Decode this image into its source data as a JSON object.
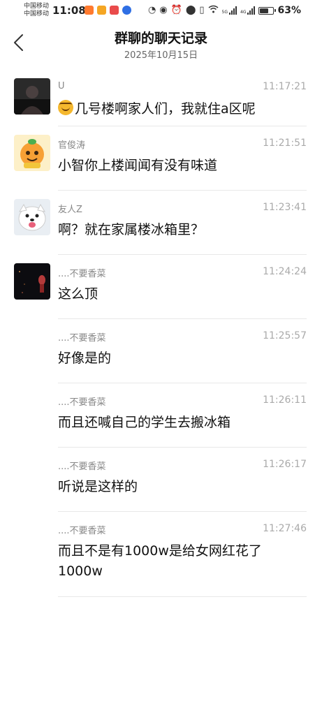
{
  "status_bar": {
    "carrier_1": "中国移动",
    "carrier_2": "中国移动",
    "time": "11:08",
    "battery_percent": "63%",
    "battery_level": 0.63,
    "app_icon_colors": [
      "#ff7a2f",
      "#f5a623",
      "#e94b4b",
      "#2f6fe4"
    ],
    "icons": [
      "speed-icon",
      "eye-icon",
      "alarm-icon",
      "location-icon",
      "vibrate-icon",
      "wifi-icon",
      "signal-5g-icon",
      "signal-4g-icon",
      "battery-icon"
    ]
  },
  "header": {
    "title": "群聊的聊天记录",
    "date": "2025年10月15日",
    "back_icon": "chevron-left-icon"
  },
  "messages": [
    {
      "sender": "U",
      "time": "11:17:21",
      "text": "几号楼啊家人们，我就住a区呢",
      "has_emoji": true,
      "avatar": "dark-figure-avatar"
    },
    {
      "sender": "官俊涛",
      "time": "11:21:51",
      "text": "小智你上楼闻闻有没有味道",
      "avatar": "orange-cartoon-avatar"
    },
    {
      "sender": "友人Z",
      "time": "11:23:41",
      "text": "啊？就在家属楼冰箱里？",
      "avatar": "white-dog-avatar"
    },
    {
      "sender": "....不要香菜",
      "time": "11:24:24",
      "text": "这么顶",
      "avatar": "dark-night-avatar"
    },
    {
      "sender": "....不要香菜",
      "time": "11:25:57",
      "text": "好像是的"
    },
    {
      "sender": "....不要香菜",
      "time": "11:26:11",
      "text": "而且还喊自己的学生去搬冰箱"
    },
    {
      "sender": "....不要香菜",
      "time": "11:26:17",
      "text": "听说是这样的"
    },
    {
      "sender": "....不要香菜",
      "time": "11:27:46",
      "text": "而且不是有1000w是给女网红花了1000w"
    }
  ]
}
